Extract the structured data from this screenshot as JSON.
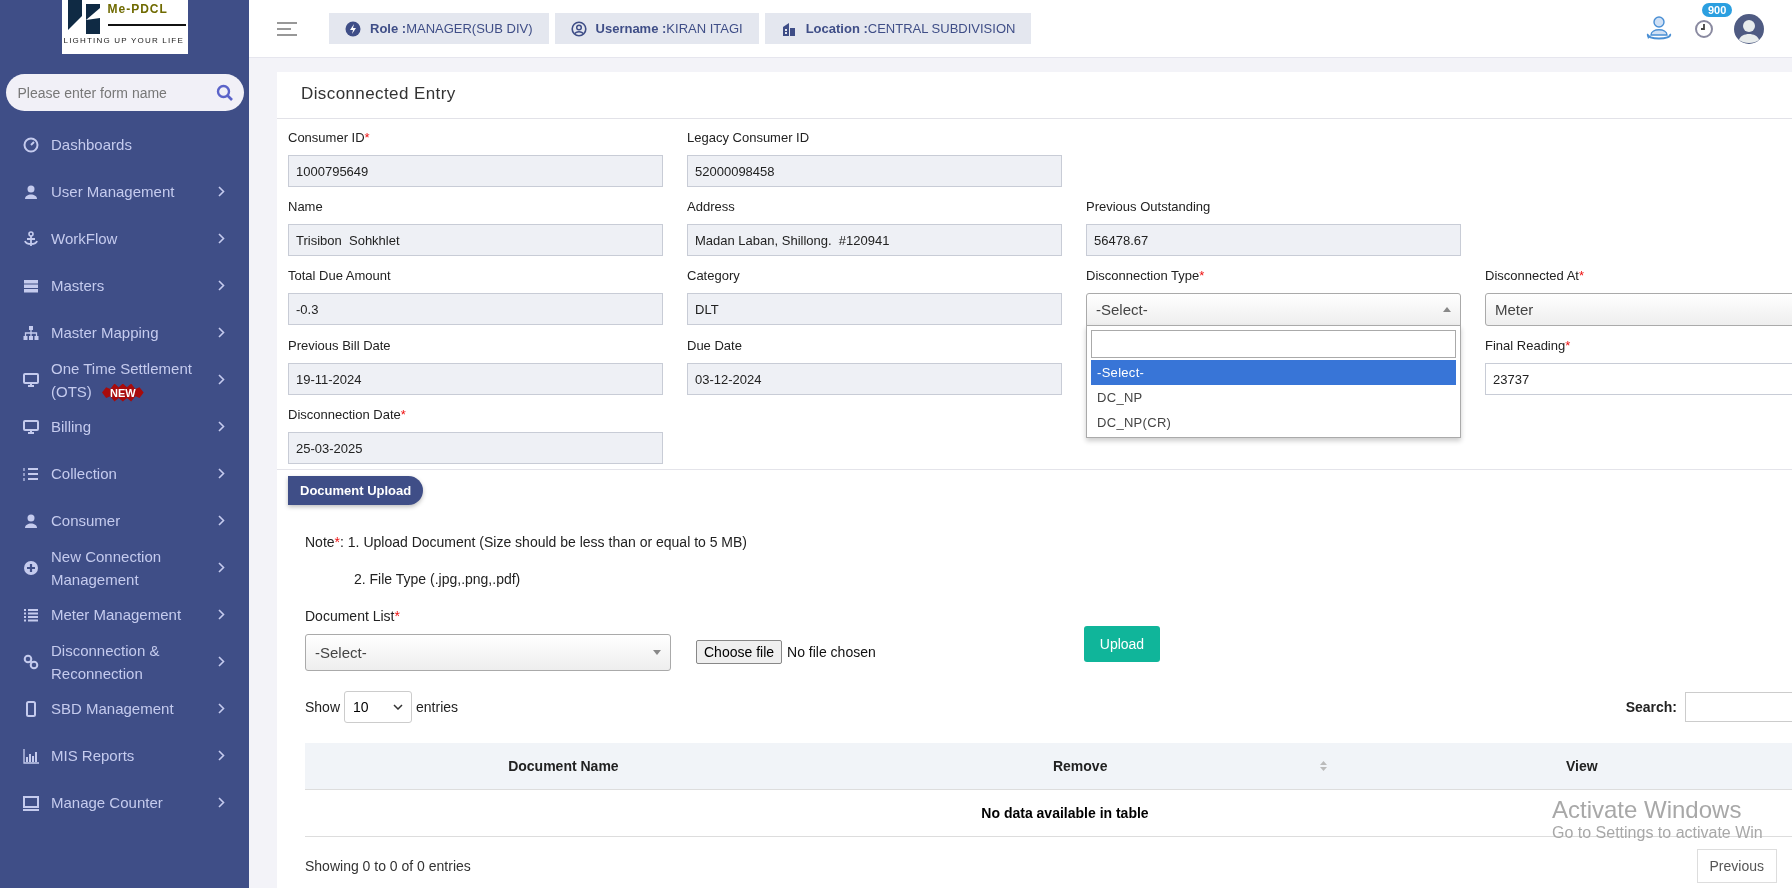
{
  "logo": {
    "name": "Me-PDCL",
    "tagline": "LIGHTING UP YOUR LIFE"
  },
  "sidebar": {
    "search": {
      "placeholder": "Please enter form name"
    },
    "items": [
      {
        "label": "Dashboards",
        "expandable": false
      },
      {
        "label": "User Management",
        "expandable": true
      },
      {
        "label": "WorkFlow",
        "expandable": true
      },
      {
        "label": "Masters",
        "expandable": true
      },
      {
        "label": "Master Mapping",
        "expandable": true
      },
      {
        "label": "One Time Settlement (OTS)",
        "badge": "NEW",
        "expandable": true
      },
      {
        "label": "Billing",
        "expandable": true
      },
      {
        "label": "Collection",
        "expandable": true
      },
      {
        "label": "Consumer",
        "expandable": true
      },
      {
        "label": "New Connection Management",
        "expandable": true
      },
      {
        "label": "Meter Management",
        "expandable": true
      },
      {
        "label": "Disconnection & Reconnection",
        "expandable": true
      },
      {
        "label": "SBD Management",
        "expandable": true
      },
      {
        "label": "MIS Reports",
        "expandable": true
      },
      {
        "label": "Manage Counter",
        "expandable": true
      }
    ]
  },
  "header": {
    "chips": [
      {
        "label": "Role :",
        "value": "MANAGER(SUB DIV)"
      },
      {
        "label": "Username :",
        "value": "KIRAN ITAGI"
      },
      {
        "label": "Location :",
        "value": "CENTRAL SUBDIVISION"
      }
    ],
    "notification_count": "900"
  },
  "page": {
    "title": "Disconnected Entry",
    "rows": [
      [
        {
          "label": "Consumer ID",
          "required_mark": "*",
          "kind": "readonly",
          "value": "1000795649"
        },
        {
          "label": "Legacy Consumer ID",
          "kind": "readonly",
          "value": "52000098458"
        }
      ],
      [
        {
          "label": "Name",
          "kind": "readonly",
          "value": "Trisibon  Sohkhlet"
        },
        {
          "label": "Address",
          "kind": "readonly",
          "value": "Madan Laban, Shillong.  #120941"
        },
        {
          "label": "Previous Outstanding",
          "kind": "readonly",
          "value": "56478.67"
        }
      ],
      [
        {
          "label": "Total Due Amount",
          "kind": "readonly",
          "value": "-0.3"
        },
        {
          "label": "Category",
          "kind": "readonly",
          "value": "DLT"
        },
        {
          "label": "Disconnection Type",
          "required_mark": "*",
          "kind": "select",
          "value": "-Select-",
          "open": true,
          "options": [
            {
              "label": "-Select-",
              "selected": true
            },
            {
              "label": "DC_NP",
              "selected": false
            },
            {
              "label": "DC_NP(CR)",
              "selected": false
            }
          ]
        },
        {
          "label": "Disconnected At",
          "required_mark": "*",
          "kind": "select",
          "value": "Meter",
          "open": false
        }
      ],
      [
        {
          "label": "Previous Bill Date",
          "kind": "readonly",
          "value": "19-11-2024"
        },
        {
          "label": "Due Date",
          "kind": "readonly",
          "value": "03-12-2024"
        },
        "",
        {
          "label": "Final Reading",
          "required_mark": "*",
          "kind": "input",
          "value": "23737"
        }
      ],
      [
        {
          "label": "Disconnection Date",
          "required_mark": "*",
          "kind": "readonly",
          "value": "25-03-2025"
        }
      ]
    ],
    "upload": {
      "section_title": "Document Upload",
      "note": {
        "label": "Note",
        "mark": "*",
        "text": ": 1. Upload Document (Size should be less than or equal to 5 MB)"
      },
      "note_2": "2. File Type (.jpg,.png,.pdf)",
      "document_list": {
        "label": "Document List",
        "required_mark": "*",
        "value": "-Select-"
      },
      "file": {
        "button": "Choose file",
        "status": "No file chosen"
      },
      "upload_button": "Upload"
    },
    "table": {
      "show_label": "Show",
      "page_size": "10",
      "entries_label": "entries",
      "search_label": "Search:",
      "columns": [
        {
          "label": "Document Name",
          "sortable": false
        },
        {
          "label": "Remove",
          "sortable": true
        },
        {
          "label": "View",
          "sortable": false
        }
      ],
      "empty_message": "No data available in table",
      "info": "Showing 0 to 0 of 0 entries",
      "previous": "Previous"
    }
  },
  "os_notice": {
    "title": "Activate Windows",
    "text": "Go to Settings to activate Win"
  }
}
